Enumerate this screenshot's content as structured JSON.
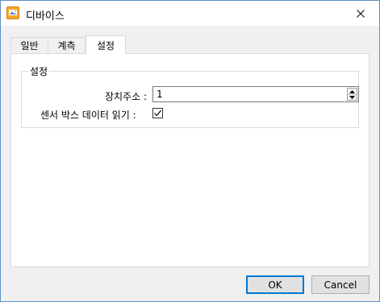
{
  "window": {
    "title": "디바이스"
  },
  "tabs": [
    {
      "label": "일반",
      "active": false
    },
    {
      "label": "계측",
      "active": false
    },
    {
      "label": "설정",
      "active": true
    }
  ],
  "settings": {
    "group_title": "설정",
    "device_address_label": "장치주소 :",
    "device_address_value": "1",
    "read_sensor_label": "센서 박스 데이터 읽기 :",
    "read_sensor_checked": true
  },
  "buttons": {
    "ok": "OK",
    "cancel": "Cancel"
  },
  "colors": {
    "window_border": "#5b8fc7",
    "default_button_border": "#0078d7",
    "panel_bg": "#f0f0f0"
  },
  "icons": {
    "app": "device-app-icon",
    "close": "close-icon",
    "spin_up": "spin-up-arrow-icon",
    "spin_down": "spin-down-arrow-icon",
    "check": "checkmark-icon"
  }
}
